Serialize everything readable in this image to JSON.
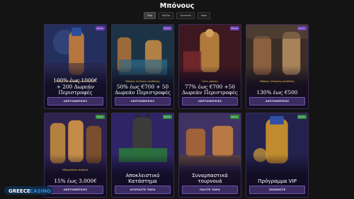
{
  "page": {
    "title": "Μπόνους"
  },
  "filters": [
    {
      "label": "Όλα",
      "active": true
    },
    {
      "label": "Καζίνο",
      "active": false
    },
    {
      "label": "Ζωντανό",
      "active": false
    },
    {
      "label": "Σπορ",
      "active": false
    }
  ],
  "cards": [
    {
      "badge": "Καζίνο",
      "badge_color": "purple",
      "subtitle": "Μπόνους Καλωσορίσματος καζίνο",
      "headline": "100% έως 1000€\n+ 200 Δωρεάν\nΠεριστροφές",
      "button": "ΛΕΠΤΟΜΕΡΕΙΕΣ",
      "art_colors": [
        "#2a3b6e",
        "#c07a3a"
      ]
    },
    {
      "badge": "Καζίνο",
      "badge_color": "purple",
      "subtitle": "Μπόνους δεύτερης κατάθεσης",
      "headline": "50% έως €700 + 50\nΔωρεάν Περιστροφές",
      "button": "ΛΕΠΤΟΜΕΡΕΙΕΣ",
      "art_colors": [
        "#1f3a4f",
        "#b8863f"
      ]
    },
    {
      "badge": "Καζίνο",
      "badge_color": "purple",
      "subtitle": "Τρίτο μπόνους",
      "headline": "77% έως €700 +50\nΔωρεάν Περιστροφές",
      "button": "ΛΕΠΤΟΜΕΡΕΙΕΣ",
      "art_colors": [
        "#5a1e2a",
        "#c28a3c"
      ]
    },
    {
      "badge": "Καζίνο",
      "badge_color": "purple",
      "subtitle": "Μπόνους τέταρτης κατάθεσης",
      "headline": "130% έως €500",
      "button": "ΛΕΠΤΟΜΕΡΕΙΕΣ",
      "art_colors": [
        "#4a3a2e",
        "#a57a4e"
      ]
    },
    {
      "badge": "Καζίνο",
      "badge_color": "green",
      "subtitle": "Εβδομαδιαίο cashback",
      "headline": "15% έως 3.000€",
      "button": "ΛΕΠΤΟΜΕΡΕΙΕΣ",
      "art_colors": [
        "#3b2a5c",
        "#c38a3c"
      ]
    },
    {
      "badge": "Καζίνο",
      "badge_color": "green",
      "subtitle": "",
      "headline": "Αποκλειστικό\nΚατάστημα",
      "button": "ΑΓΟΡΑΣΤΕ ΤΩΡΑ",
      "art_colors": [
        "#3a2a6e",
        "#2a7a3a"
      ]
    },
    {
      "badge": "Καζίνο",
      "badge_color": "green",
      "subtitle": "",
      "headline": "Συναρπαστικά\nτουρνουά",
      "button": "ΠΑΙΞΤΕ ΤΩΡΑ",
      "art_colors": [
        "#4a3a6e",
        "#b0703a"
      ]
    },
    {
      "badge": "Καζίνο",
      "badge_color": "green",
      "subtitle": "",
      "headline": "Πρόγραμμα VIP",
      "button": "ΞΕΚΙΝΗΣΤΕ",
      "art_colors": [
        "#2a2a5e",
        "#c08a2e"
      ]
    }
  ],
  "logo": {
    "text": "GREECE CASINO",
    "accent": "#2b8de0"
  }
}
